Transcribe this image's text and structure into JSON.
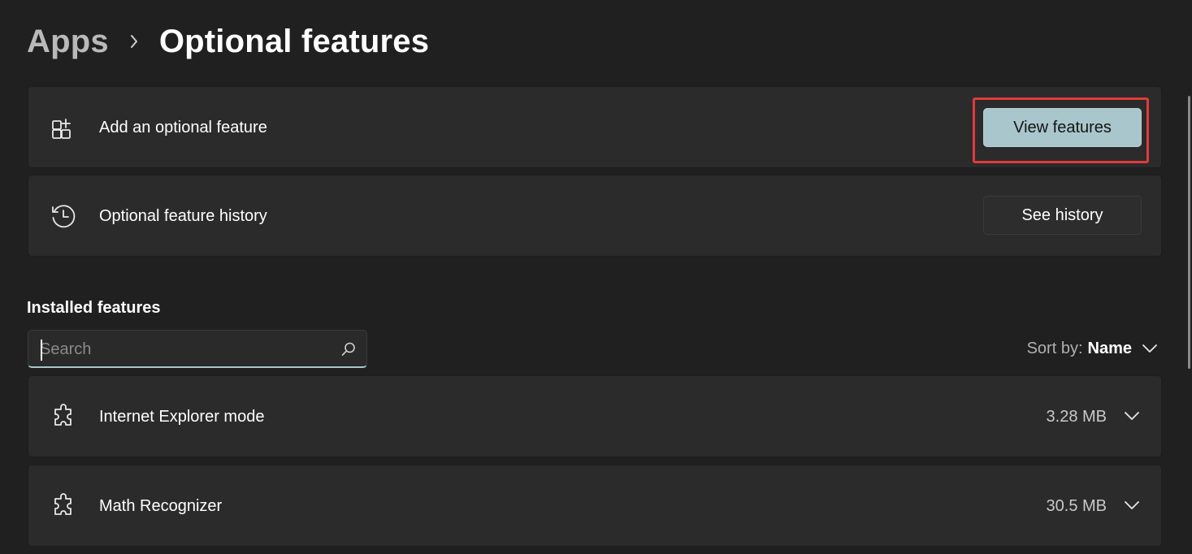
{
  "breadcrumb": {
    "parent": "Apps",
    "current": "Optional features"
  },
  "add_feature": {
    "label": "Add an optional feature",
    "button": "View features",
    "icon": "add-apps-icon"
  },
  "history": {
    "label": "Optional feature history",
    "button": "See history",
    "icon": "history-icon"
  },
  "installed": {
    "title": "Installed features",
    "search_placeholder": "Search",
    "sort_label": "Sort by:",
    "sort_value": "Name",
    "items": [
      {
        "name": "Internet Explorer mode",
        "size": "3.28 MB",
        "icon": "puzzle-icon"
      },
      {
        "name": "Math Recognizer",
        "size": "30.5 MB",
        "icon": "puzzle-icon"
      }
    ]
  },
  "colors": {
    "background": "#202020",
    "card": "#2b2b2b",
    "accent": "#a9c6cc",
    "highlight": "#e03b3b"
  }
}
